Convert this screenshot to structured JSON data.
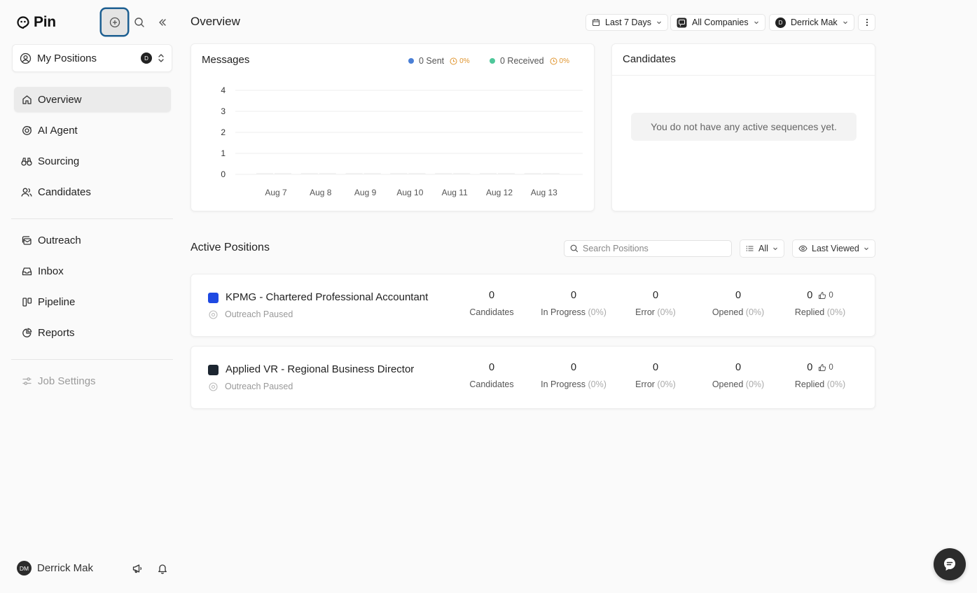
{
  "app": {
    "name": "Pin"
  },
  "sidebar": {
    "positions_select": {
      "label": "My Positions",
      "avatar": "D"
    },
    "items": [
      {
        "label": "Overview",
        "icon": "home-icon"
      },
      {
        "label": "AI Agent",
        "icon": "ai-agent-icon"
      },
      {
        "label": "Sourcing",
        "icon": "binoculars-icon"
      },
      {
        "label": "Candidates",
        "icon": "users-icon"
      },
      {
        "label": "Outreach",
        "icon": "outreach-icon"
      },
      {
        "label": "Inbox",
        "icon": "inbox-icon"
      },
      {
        "label": "Pipeline",
        "icon": "pipeline-icon"
      },
      {
        "label": "Reports",
        "icon": "pie-chart-icon"
      },
      {
        "label": "Job Settings",
        "icon": "sliders-icon"
      }
    ],
    "user": {
      "initials": "DM",
      "name": "Derrick Mak"
    }
  },
  "header": {
    "title": "Overview",
    "date_range": "Last 7 Days",
    "company": "All Companies",
    "user_filter": {
      "initial": "D",
      "name": "Derrick Mak"
    }
  },
  "messages_card": {
    "title": "Messages",
    "sent": {
      "label": "0 Sent",
      "pct": "0%",
      "color": "#4a7fd6"
    },
    "received": {
      "label": "0 Received",
      "pct": "0%",
      "color": "#4ec79a"
    }
  },
  "chart_data": {
    "type": "bar",
    "categories": [
      "Aug 7",
      "Aug 8",
      "Aug 9",
      "Aug 10",
      "Aug 11",
      "Aug 12",
      "Aug 13"
    ],
    "series": [
      {
        "name": "Sent",
        "values": [
          0,
          0,
          0,
          0,
          0,
          0,
          0
        ]
      },
      {
        "name": "Received",
        "values": [
          0,
          0,
          0,
          0,
          0,
          0,
          0
        ]
      }
    ],
    "yticks": [
      "0",
      "1",
      "2",
      "3",
      "4"
    ],
    "ylim": [
      0,
      4
    ],
    "grid": true
  },
  "candidates_card": {
    "title": "Candidates",
    "empty_message": "You do not have any active sequences yet."
  },
  "active_positions": {
    "title": "Active Positions",
    "search_placeholder": "Search Positions",
    "filter": "All",
    "sort": "Last Viewed",
    "positions": [
      {
        "name": "KPMG - Chartered Professional Accountant",
        "status": "Outreach Paused",
        "logo_color": "#1e49e2",
        "stats": [
          {
            "value": "0",
            "label": "Candidates",
            "pct": ""
          },
          {
            "value": "0",
            "label": "In Progress",
            "pct": "(0%)"
          },
          {
            "value": "0",
            "label": "Error",
            "pct": "(0%)"
          },
          {
            "value": "0",
            "label": "Opened",
            "pct": "(0%)"
          },
          {
            "value": "0",
            "label": "Replied",
            "pct": "(0%)",
            "likes": "0"
          }
        ]
      },
      {
        "name": "Applied VR - Regional Business Director",
        "status": "Outreach Paused",
        "logo_color": "#1c2530",
        "stats": [
          {
            "value": "0",
            "label": "Candidates",
            "pct": ""
          },
          {
            "value": "0",
            "label": "In Progress",
            "pct": "(0%)"
          },
          {
            "value": "0",
            "label": "Error",
            "pct": "(0%)"
          },
          {
            "value": "0",
            "label": "Opened",
            "pct": "(0%)"
          },
          {
            "value": "0",
            "label": "Replied",
            "pct": "(0%)",
            "likes": "0"
          }
        ]
      }
    ]
  }
}
